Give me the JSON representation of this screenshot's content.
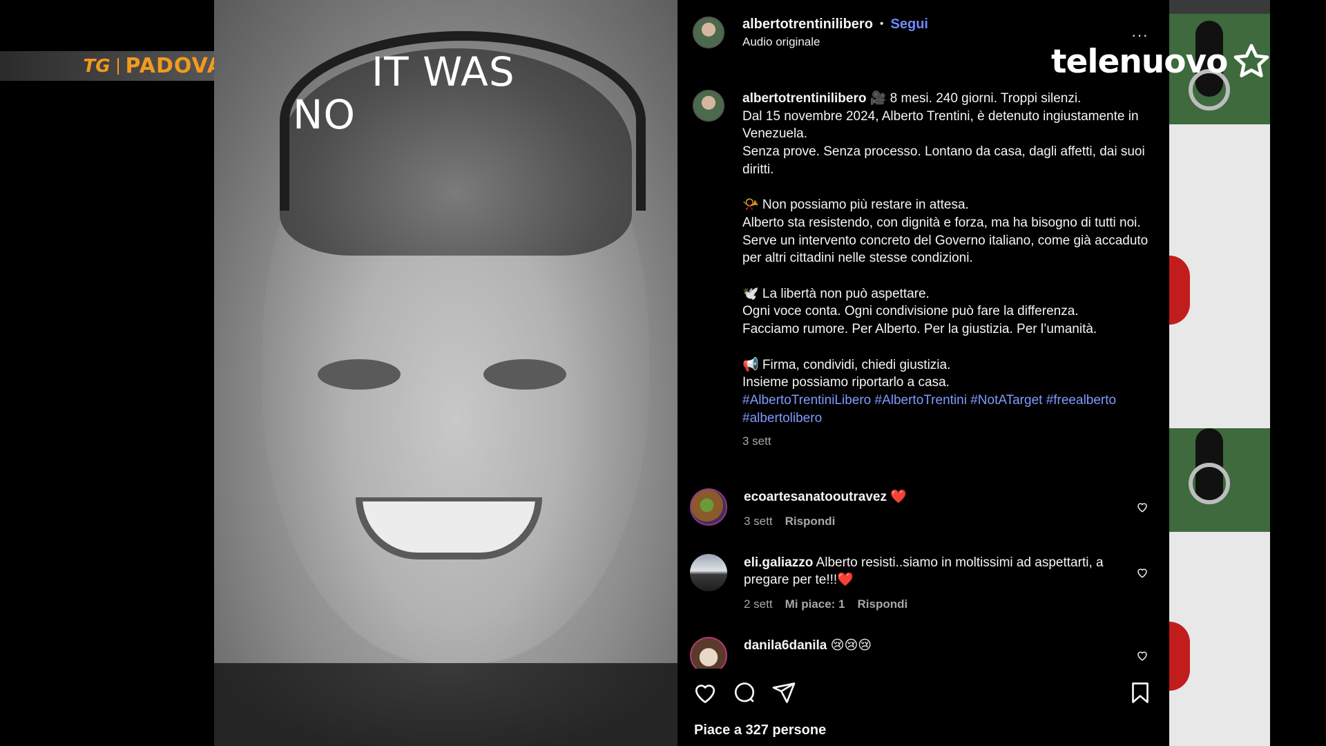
{
  "overlay": {
    "tg_logo": "TG",
    "city": "PADOVA",
    "channel": "telenuovo"
  },
  "photo": {
    "line1": "IT WAS",
    "line2": "NO"
  },
  "post": {
    "username": "albertotrentinilibero",
    "separator": "•",
    "follow_label": "Segui",
    "audio": "Audio originale",
    "more_label": "···",
    "caption": {
      "username": "albertotrentinilibero",
      "lines": [
        "🎥 8 mesi. 240 giorni. Troppi silenzi.",
        "Dal 15 novembre 2024, Alberto Trentini, è detenuto ingiustamente in Venezuela.",
        "Senza prove. Senza processo. Lontano da casa, dagli affetti, dai suoi diritti.",
        "",
        "📯 Non possiamo più restare in attesa.",
        "Alberto sta resistendo, con dignità e forza, ma ha bisogno di tutti noi.",
        "Serve un intervento concreto del Governo italiano, come già accaduto per altri cittadini nelle stesse condizioni.",
        "",
        "🕊️ La libertà non può aspettare.",
        "Ogni voce conta. Ogni condivisione può fare la differenza.",
        "Facciamo rumore. Per Alberto. Per la giustizia. Per l’umanità.",
        "",
        "📢 Firma, condividi, chiedi giustizia.",
        "Insieme possiamo riportarlo a casa."
      ],
      "hashtags": "#AlbertoTrentiniLibero #AlbertoTrentini #NotATarget #freealberto #albertolibero",
      "time": "3 sett"
    },
    "comments": [
      {
        "username": "ecoartesanatooutravez",
        "text": "❤️",
        "time": "3 sett",
        "likes": "",
        "reply": "Rispondi"
      },
      {
        "username": "eli.galiazzo",
        "text": "Alberto resisti..siamo in moltissimi ad aspettarti, a pregare per te!!!❤️",
        "time": "2 sett",
        "likes": "Mi piace: 1",
        "reply": "Rispondi"
      },
      {
        "username": "danila6danila",
        "text": "😢😢😢",
        "time": "",
        "likes": "",
        "reply": ""
      }
    ],
    "likes_text": "Piace a 327 persone"
  },
  "icons": {
    "like": "heart-icon",
    "comment": "comment-icon",
    "share": "send-icon",
    "save": "bookmark-icon",
    "star": "star-icon"
  },
  "colors": {
    "accent_orange": "#f39a1e",
    "link_blue": "#6f8bff",
    "hashtag_blue": "#7f9bff",
    "heart_red": "#e0213b"
  }
}
